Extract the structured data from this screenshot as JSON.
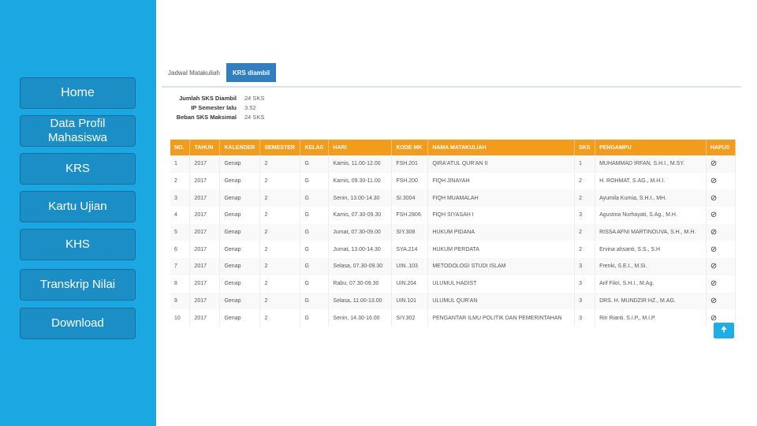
{
  "sidebar": {
    "items": [
      {
        "label": "Home"
      },
      {
        "label": "Data Profil Mahasiswa"
      },
      {
        "label": "KRS"
      },
      {
        "label": "Kartu Ujian"
      },
      {
        "label": "KHS"
      },
      {
        "label": "Transkrip Nilai"
      },
      {
        "label": "Download"
      }
    ]
  },
  "tabs": [
    {
      "label": "Jadwal Matakuliah"
    },
    {
      "label": "KRS diambil"
    }
  ],
  "summary": [
    {
      "label": "Jumlah SKS Diambil",
      "value": "24 SKS"
    },
    {
      "label": "IP Semester lalu",
      "value": "3.52"
    },
    {
      "label": "Beban SKS Maksimal",
      "value": "24 SKS"
    }
  ],
  "table": {
    "headers": [
      "NO.",
      "TAHUN",
      "KALENDER",
      "SEMESTER",
      "KELAS",
      "HARI",
      "KODE MK",
      "NAMA MATAKULIAH",
      "SKS",
      "PENGAMPU",
      "HAPUS"
    ],
    "rows": [
      [
        "1",
        "2017",
        "Genap",
        "2",
        "G",
        "Kamis, 11.00-12.00",
        "FSH.201",
        "QIRA'ATUL QUR'AN II",
        "1",
        "MUHAMMAD IRFAN, S.H.I., M.SY."
      ],
      [
        "2",
        "2017",
        "Genap",
        "2",
        "G",
        "Kamis, 09.30-11.00",
        "FSH.200",
        "FIQH JINAYAH",
        "2",
        "H. ROHMAT, S.AG., M.H.I."
      ],
      [
        "3",
        "2017",
        "Genap",
        "2",
        "G",
        "Senin, 13.00-14.30",
        "SI.3004",
        "FIQH MUAMALAH",
        "2",
        "Ayumila Kurnia, S.H.I., MH."
      ],
      [
        "4",
        "2017",
        "Genap",
        "2",
        "G",
        "Kamis, 07.30-09.30",
        "FSH.2806",
        "FIQH SIYASAH I",
        "3",
        "Agustina Nurhayati, S.Ag., M.H."
      ],
      [
        "5",
        "2017",
        "Genap",
        "2",
        "G",
        "Jumat, 07.30-09.00",
        "SIY.308",
        "HUKUM PIDANA",
        "2",
        "RISSA AFNI MARTINOUVA, S.H., M.H."
      ],
      [
        "6",
        "2017",
        "Genap",
        "2",
        "G",
        "Jumat, 13.00-14.30",
        "SYA.214",
        "HUKUM PERDATA",
        "2",
        "Ervina ahsanti, S.S., S.H"
      ],
      [
        "7",
        "2017",
        "Genap",
        "2",
        "G",
        "Selasa, 07.30-09.30",
        "UIN..103",
        "METODOLOGI STUDI ISLAM",
        "3",
        "Frenki, S.E.I., M.Si."
      ],
      [
        "8",
        "2017",
        "Genap",
        "2",
        "G",
        "Rabu, 07.30-09.30",
        "UIN.204",
        "ULUMUL HADIST",
        "3",
        "Arif Fikri, S.H.I., M.Ag."
      ],
      [
        "9",
        "2017",
        "Genap",
        "2",
        "G",
        "Selasa, 11.00-13.00",
        "UIN.101",
        "ULUMUL QUR'AN",
        "3",
        "DRS. H. MUNDZIR HZ., M.AG."
      ],
      [
        "10",
        "2017",
        "Genap",
        "2",
        "G",
        "Senin, 14.30-16.00",
        "SIY.302",
        "PENGANTAR ILMU POLITIK DAN PEMERINTAHAN",
        "3",
        "Riri Rianti. S.I.P., M.I.P."
      ]
    ]
  },
  "icons": {
    "delete": "ban-icon",
    "scroll_top": "arrow-up-icon"
  },
  "colors": {
    "sidebar": "#1ba7e1",
    "header": "#f39c1b",
    "active_tab": "#2f7fc1"
  }
}
